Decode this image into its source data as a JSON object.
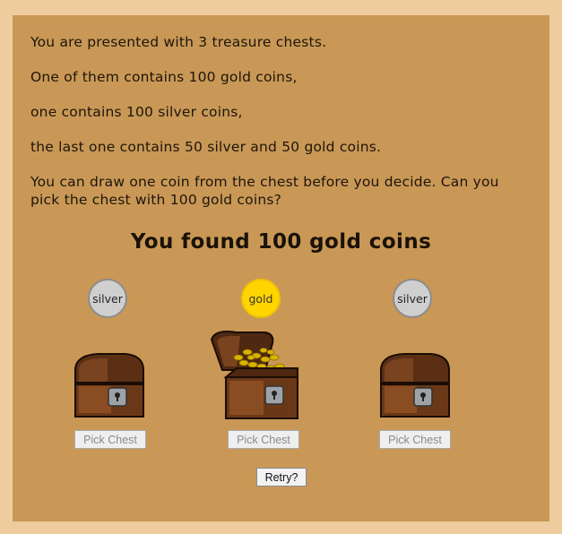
{
  "intro": {
    "line1": "You are presented with 3 treasure chests.",
    "line2": "One of them contains 100 gold coins,",
    "line3": "one contains 100 silver coins,",
    "line4": "the last one contains 50 silver and 50 gold coins.",
    "line5": "You can draw one coin from the chest before you decide. Can you pick the chest with 100 gold coins?"
  },
  "result": "You found 100 gold coins",
  "chests": [
    {
      "coin": "silver",
      "coin_type": "silver",
      "state": "closed",
      "button": "Pick Chest"
    },
    {
      "coin": "gold",
      "coin_type": "gold",
      "state": "open-with-gold",
      "button": "Pick Chest"
    },
    {
      "coin": "silver",
      "coin_type": "silver",
      "state": "closed",
      "button": "Pick Chest"
    }
  ],
  "retry": "Retry?",
  "colors": {
    "page_background": "#efcc9e",
    "panel_background": "#c99856",
    "gold_coin": "#ffd500",
    "silver_coin": "#cfcfcf"
  }
}
